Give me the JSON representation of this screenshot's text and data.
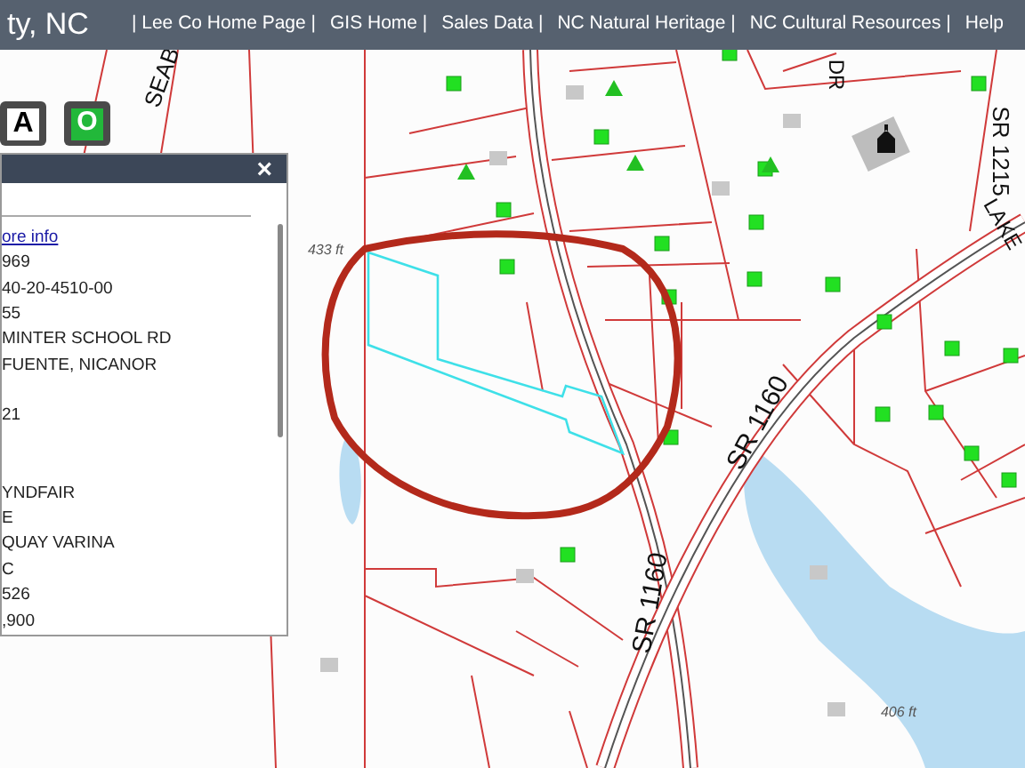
{
  "header": {
    "title": "ty, NC",
    "links": [
      "| Lee Co Home Page |",
      "GIS Home |",
      "Sales Data |",
      "NC Natural Heritage |",
      "NC Cultural Resources |",
      "Help"
    ]
  },
  "map_tools": [
    {
      "label": "A",
      "kind": "text"
    },
    {
      "label": "O",
      "kind": "circle"
    }
  ],
  "popup": {
    "close": "×",
    "link": "ore info",
    "rows": [
      "969",
      "40-20-4510-00",
      "55",
      "MINTER SCHOOL RD",
      "FUENTE, NICANOR",
      "",
      "21",
      "",
      "",
      "YNDFAIR",
      "E",
      "QUAY VARINA",
      "C",
      "526",
      ",900"
    ]
  },
  "map_labels": [
    {
      "text": "SEAB",
      "kind": "road"
    },
    {
      "text": "DR",
      "kind": "road"
    },
    {
      "text": "SR 1215",
      "kind": "road"
    },
    {
      "text": "LAKE",
      "kind": "road"
    },
    {
      "text": "SR 1160",
      "kind": "road"
    },
    {
      "text": "SR 1160",
      "kind": "road"
    },
    {
      "text": "433 ft",
      "kind": "elevation"
    },
    {
      "text": "406 ft",
      "kind": "elevation"
    }
  ]
}
